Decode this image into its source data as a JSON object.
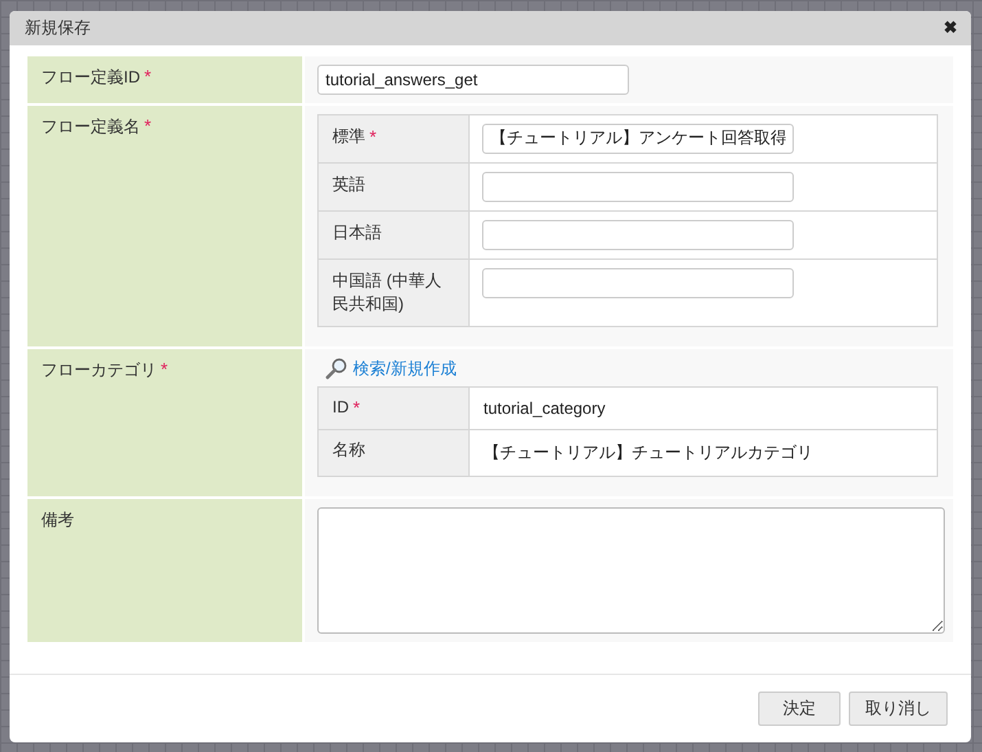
{
  "dialog": {
    "title": "新規保存",
    "close": "✖"
  },
  "rows": [
    {
      "kind": "input",
      "label": "フロー定義ID",
      "mark": "*",
      "value": "tutorial_answers_get"
    },
    {
      "kind": "languages",
      "label": "フロー定義名",
      "mark": "*",
      "languages": [
        {
          "label": "標準",
          "mark": "*",
          "value": "【チュートリアル】アンケート回答取得"
        },
        {
          "label": "英語"
        },
        {
          "label": "日本語"
        },
        {
          "label": "中国語 (中華人民共和国)"
        }
      ]
    },
    {
      "kind": "lookup",
      "label": "フローカテゴリ",
      "mark": "*",
      "link": "検索/新規作成",
      "fields": [
        {
          "label": "ID",
          "mark": "*",
          "value": "tutorial_category"
        },
        {
          "label": "名称",
          "value": "【チュートリアル】チュートリアルカテゴリ"
        }
      ]
    },
    {
      "kind": "textarea",
      "label": "備考"
    }
  ],
  "buttons": [
    "決定",
    "取り消し"
  ]
}
